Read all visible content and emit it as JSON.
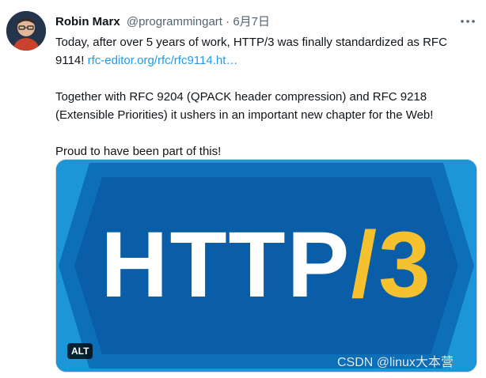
{
  "tweet": {
    "author": {
      "display_name": "Robin Marx",
      "handle": "@programmingart"
    },
    "separator": "·",
    "date": "6月7日",
    "paragraphs": {
      "p1_text": "Today, after over 5 years of work, HTTP/3 was finally standardized as RFC 9114! ",
      "p1_link": "rfc-editor.org/rfc/rfc9114.ht…",
      "p2": "Together with RFC 9204 (QPACK header compression) and RFC 9218 (Extensible Priorities) it ushers in an important new chapter for the Web!",
      "p3": "Proud to have been part of this!"
    },
    "media": {
      "image_text_main": "HTTP",
      "image_text_accent": "/3",
      "alt_badge": "ALT"
    },
    "more_icon": "more-dots-icon"
  },
  "watermark": "CSDN @linux大本营",
  "colors": {
    "link": "#1d9bf0",
    "text": "#0f1419",
    "muted": "#536471",
    "image_bg": "#0d78c0",
    "image_hex_dark": "#0a5ea8",
    "image_hex_light": "#1c96d6",
    "accent_yellow": "#f6c12e"
  }
}
